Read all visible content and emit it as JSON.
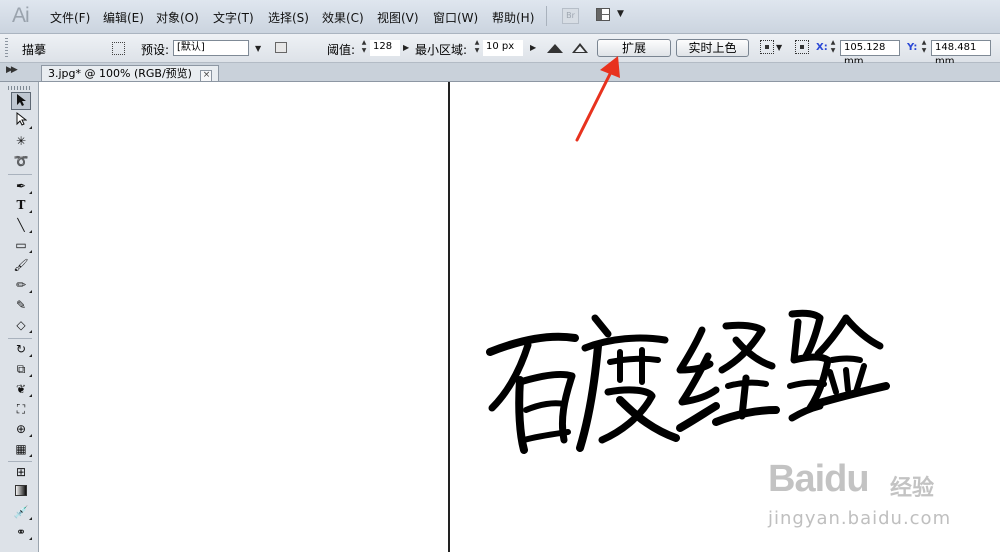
{
  "app": {
    "logo": "Ai"
  },
  "menubar": {
    "items": [
      {
        "label": "文件(F)"
      },
      {
        "label": "编辑(E)"
      },
      {
        "label": "对象(O)"
      },
      {
        "label": "文字(T)"
      },
      {
        "label": "选择(S)"
      },
      {
        "label": "效果(C)"
      },
      {
        "label": "视图(V)"
      },
      {
        "label": "窗口(W)"
      },
      {
        "label": "帮助(H)"
      }
    ],
    "bridge_icon_text": "Br"
  },
  "controlbar": {
    "title": "描摹",
    "preset_label": "预设:",
    "preset_value": "[默认]",
    "threshold_label": "阈值:",
    "threshold_value": "128",
    "min_area_label": "最小区域:",
    "min_area_value": "10 px",
    "expand_button": "扩展",
    "live_paint_button": "实时上色",
    "x_label": "X:",
    "x_value": "105.128 mm",
    "y_label": "Y:",
    "y_value": "148.481 mm"
  },
  "document": {
    "tab_title": "3.jpg* @ 100% (RGB/预览)",
    "close_glyph": "×"
  },
  "artwork": {
    "text": "百度经验"
  },
  "watermark": {
    "logo": "Baidu",
    "cn": "经验",
    "url": "jingyan.baidu.com"
  },
  "colors": {
    "annotation_arrow": "#e8321e",
    "menubar_bg": "#d4dce6",
    "canvas_bg": "#ffffff"
  }
}
